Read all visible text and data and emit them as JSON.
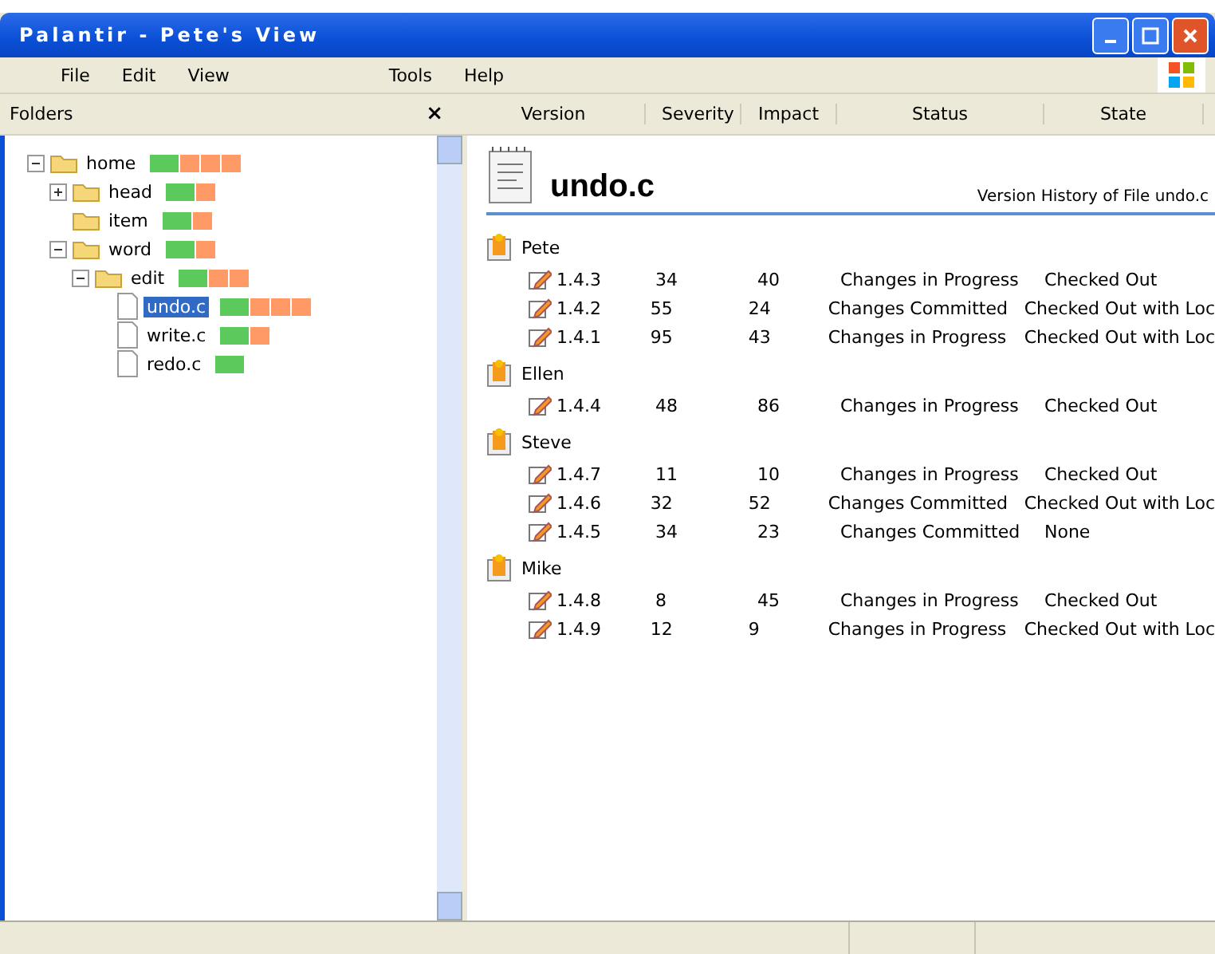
{
  "window": {
    "title": "Palantir - Pete's View"
  },
  "menu": [
    "File",
    "Edit",
    "View",
    "Tools",
    "Help"
  ],
  "folders_pane": {
    "title": "Folders",
    "close": "×"
  },
  "tree": [
    {
      "label": "home",
      "kind": "folder",
      "expanded": true,
      "selected": false,
      "segments": [
        {
          "color": "#5cc95c"
        },
        {
          "color": "#ff9966"
        },
        {
          "color": "#ff9966"
        },
        {
          "color": "#ff9966"
        }
      ],
      "children": [
        {
          "label": "head",
          "kind": "folder",
          "expanded": false,
          "selected": false,
          "segments": [
            {
              "color": "#5cc95c"
            },
            {
              "color": "#ff9966"
            }
          ]
        },
        {
          "label": "item",
          "kind": "folder",
          "selected": false,
          "segments": [
            {
              "color": "#5cc95c"
            },
            {
              "color": "#ff9966"
            }
          ]
        },
        {
          "label": "word",
          "kind": "folder",
          "expanded": true,
          "selected": false,
          "segments": [
            {
              "color": "#5cc95c"
            },
            {
              "color": "#ff9966"
            }
          ],
          "children": [
            {
              "label": "edit",
              "kind": "folder",
              "expanded": true,
              "selected": false,
              "segments": [
                {
                  "color": "#5cc95c"
                },
                {
                  "color": "#ff9966"
                },
                {
                  "color": "#ff9966"
                }
              ],
              "children": [
                {
                  "label": "undo.c",
                  "kind": "file",
                  "selected": true,
                  "segments": [
                    {
                      "color": "#5cc95c"
                    },
                    {
                      "color": "#ff9966"
                    },
                    {
                      "color": "#ff9966"
                    },
                    {
                      "color": "#ff9966"
                    }
                  ]
                },
                {
                  "label": "write.c",
                  "kind": "file",
                  "selected": false,
                  "segments": [
                    {
                      "color": "#5cc95c"
                    },
                    {
                      "color": "#ff9966"
                    }
                  ]
                },
                {
                  "label": "redo.c",
                  "kind": "file",
                  "selected": false,
                  "segments": [
                    {
                      "color": "#5cc95c"
                    }
                  ]
                }
              ]
            }
          ]
        }
      ]
    }
  ],
  "table": {
    "columns": [
      "Version",
      "Severity",
      "Impact",
      "Status",
      "State"
    ]
  },
  "file": {
    "name": "undo.c",
    "subtitle": "Version History of File undo.c"
  },
  "groups": [
    {
      "user": "Pete",
      "rows": [
        [
          "1.4.3",
          "34",
          "40",
          "Changes in Progress",
          "Checked Out"
        ],
        [
          "1.4.2",
          "55",
          "24",
          "Changes Committed",
          "Checked Out with Loc"
        ],
        [
          "1.4.1",
          "95",
          "43",
          "Changes in Progress",
          "Checked Out with Loc"
        ]
      ]
    },
    {
      "user": "Ellen",
      "rows": [
        [
          "1.4.4",
          "48",
          "86",
          "Changes in Progress",
          "Checked Out"
        ]
      ]
    },
    {
      "user": "Steve",
      "rows": [
        [
          "1.4.7",
          "11",
          "10",
          "Changes in Progress",
          "Checked Out"
        ],
        [
          "1.4.6",
          "32",
          "52",
          "Changes Committed",
          "Checked Out with Loc"
        ],
        [
          "1.4.5",
          "34",
          "23",
          "Changes Committed",
          "None"
        ]
      ]
    },
    {
      "user": "Mike",
      "rows": [
        [
          "1.4.8",
          "8",
          "45",
          "Changes in Progress",
          "Checked Out"
        ],
        [
          "1.4.9",
          "12",
          "9",
          "Changes in Progress",
          "Checked Out with Loc"
        ]
      ]
    }
  ]
}
